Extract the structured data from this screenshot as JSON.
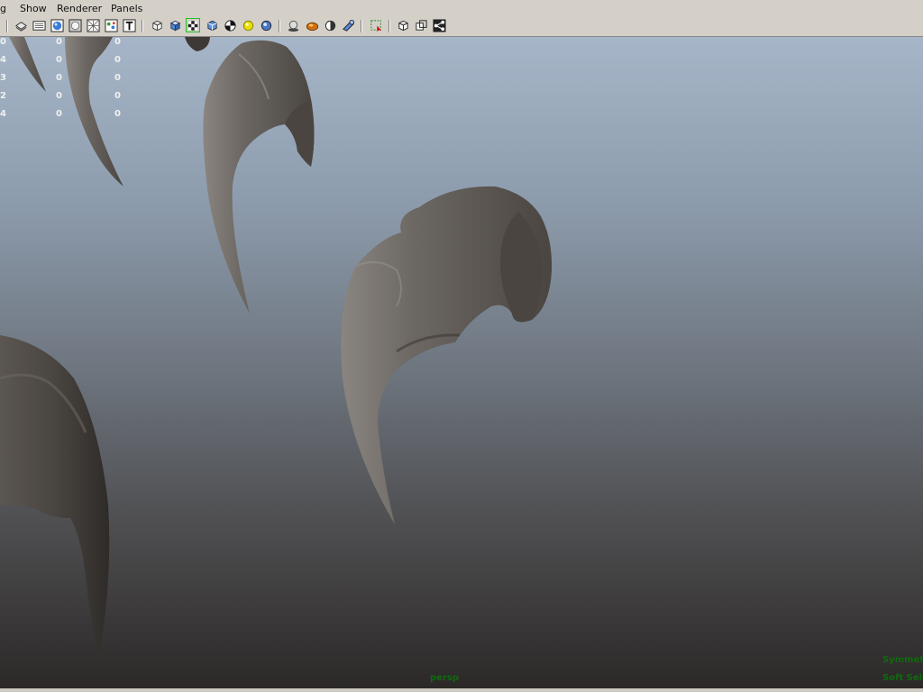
{
  "menus": [
    "g",
    "Show",
    "Renderer",
    "Panels"
  ],
  "toolbar": {
    "icons": [
      "camera-attributes-icon",
      "image-plane-icon",
      "shaded-sphere-icon",
      "grease-pencil-icon",
      "wireframe-icon",
      "smooth-shade-icon",
      "text-tool-icon",
      "wireframe-cube-icon",
      "shaded-cube-icon",
      "textured-cube-icon",
      "shaded-wireframe-cube-icon",
      "checker-texture-icon",
      "lit-sphere-icon",
      "default-light-icon",
      "shadows-icon",
      "ambient-occlusion-icon",
      "anti-alias-icon",
      "depth-of-field-icon",
      "isolate-select-icon",
      "xray-icon",
      "xray-joints-icon",
      "hud-icon"
    ]
  },
  "hud": {
    "rows": [
      {
        "label": "0",
        "a": "0",
        "b": "0"
      },
      {
        "label": "4",
        "a": "0",
        "b": "0"
      },
      {
        "label": "3",
        "a": "0",
        "b": "0"
      },
      {
        "label": "2",
        "a": "0",
        "b": "0"
      },
      {
        "label": "4",
        "a": "0",
        "b": "0"
      }
    ],
    "camera": "persp",
    "symmetry": "Symmetry",
    "soft_select": "Soft Sele"
  }
}
